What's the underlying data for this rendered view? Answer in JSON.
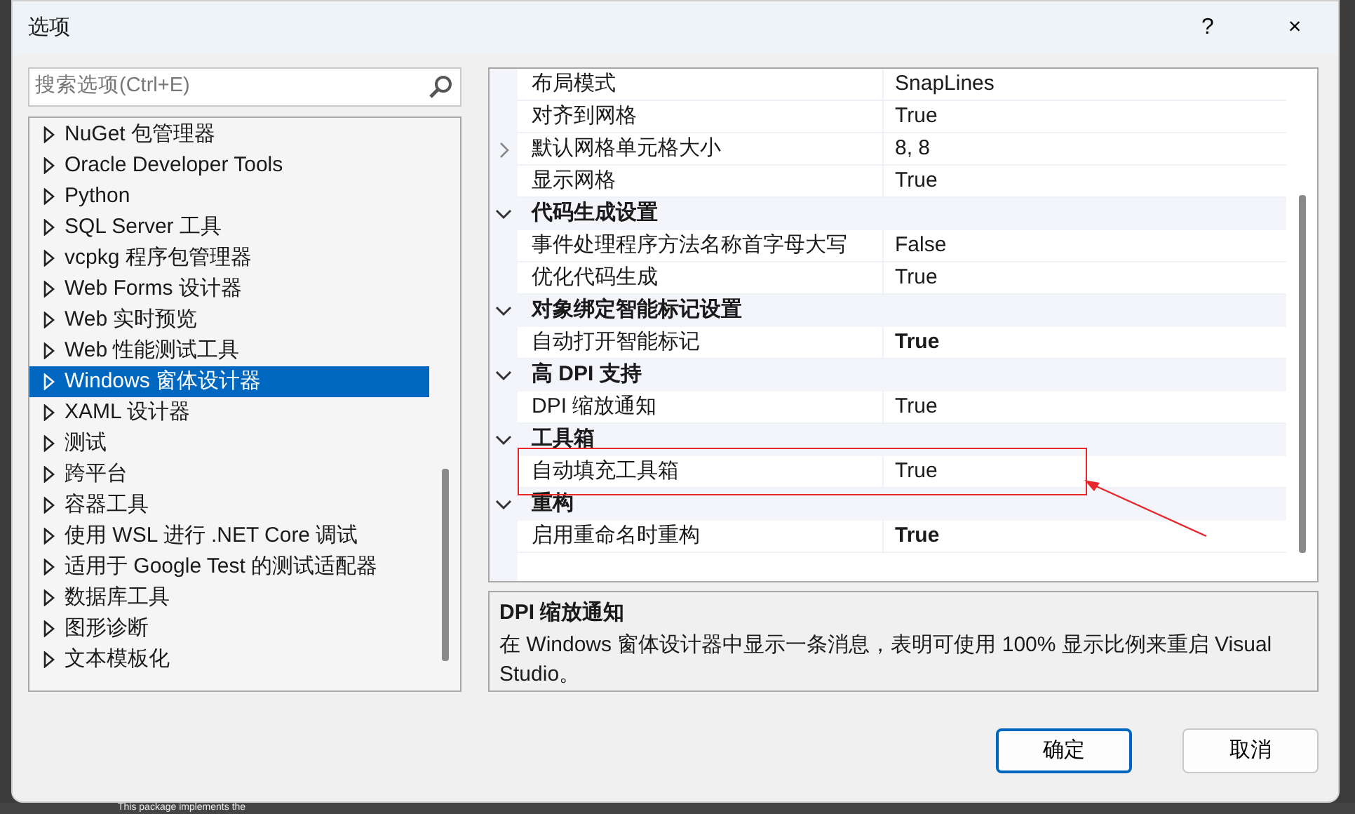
{
  "window": {
    "title": "选项",
    "help": "?",
    "close": "×"
  },
  "search": {
    "placeholder": "搜索选项(Ctrl+E)"
  },
  "tree": [
    {
      "label": "NuGet 包管理器",
      "selected": false
    },
    {
      "label": "Oracle Developer Tools",
      "selected": false
    },
    {
      "label": "Python",
      "selected": false
    },
    {
      "label": "SQL Server 工具",
      "selected": false
    },
    {
      "label": "vcpkg 程序包管理器",
      "selected": false
    },
    {
      "label": "Web Forms 设计器",
      "selected": false
    },
    {
      "label": "Web 实时预览",
      "selected": false
    },
    {
      "label": "Web 性能测试工具",
      "selected": false
    },
    {
      "label": "Windows 窗体设计器",
      "selected": true
    },
    {
      "label": "XAML 设计器",
      "selected": false
    },
    {
      "label": "测试",
      "selected": false
    },
    {
      "label": "跨平台",
      "selected": false
    },
    {
      "label": "容器工具",
      "selected": false
    },
    {
      "label": "使用 WSL 进行 .NET Core 调试",
      "selected": false
    },
    {
      "label": "适用于 Google Test 的测试适配器",
      "selected": false
    },
    {
      "label": "数据库工具",
      "selected": false
    },
    {
      "label": "图形诊断",
      "selected": false
    },
    {
      "label": "文本模板化",
      "selected": false
    }
  ],
  "properties": [
    {
      "kind": "property",
      "name": "布局模式",
      "value": "SnapLines",
      "bold": false
    },
    {
      "kind": "property",
      "name": "对齐到网格",
      "value": "True",
      "bold": false
    },
    {
      "kind": "property",
      "name": "默认网格单元格大小",
      "value": "8, 8",
      "bold": false,
      "expandable": true
    },
    {
      "kind": "property",
      "name": "显示网格",
      "value": "True",
      "bold": false
    },
    {
      "kind": "category",
      "name": "代码生成设置",
      "expanded": true
    },
    {
      "kind": "property",
      "name": "事件处理程序方法名称首字母大写",
      "value": "False",
      "bold": false
    },
    {
      "kind": "property",
      "name": "优化代码生成",
      "value": "True",
      "bold": false
    },
    {
      "kind": "category",
      "name": "对象绑定智能标记设置",
      "expanded": true
    },
    {
      "kind": "property",
      "name": "自动打开智能标记",
      "value": "True",
      "bold": true
    },
    {
      "kind": "category",
      "name": "高 DPI 支持",
      "expanded": true
    },
    {
      "kind": "property",
      "name": "DPI 缩放通知",
      "value": "True",
      "bold": false
    },
    {
      "kind": "category",
      "name": "工具箱",
      "expanded": true
    },
    {
      "kind": "property",
      "name": "自动填充工具箱",
      "value": "True",
      "bold": false,
      "highlighted": true
    },
    {
      "kind": "category",
      "name": "重构",
      "expanded": true
    },
    {
      "kind": "property",
      "name": "启用重命名时重构",
      "value": "True",
      "bold": true
    }
  ],
  "description": {
    "title": "DPI 缩放通知",
    "text": "在 Windows 窗体设计器中显示一条消息，表明可使用 100% 显示比例来重启 Visual Studio。"
  },
  "buttons": [
    {
      "label": "确定",
      "default": true
    },
    {
      "label": "取消",
      "default": false
    }
  ],
  "background": {
    "text": "This package implements the"
  }
}
